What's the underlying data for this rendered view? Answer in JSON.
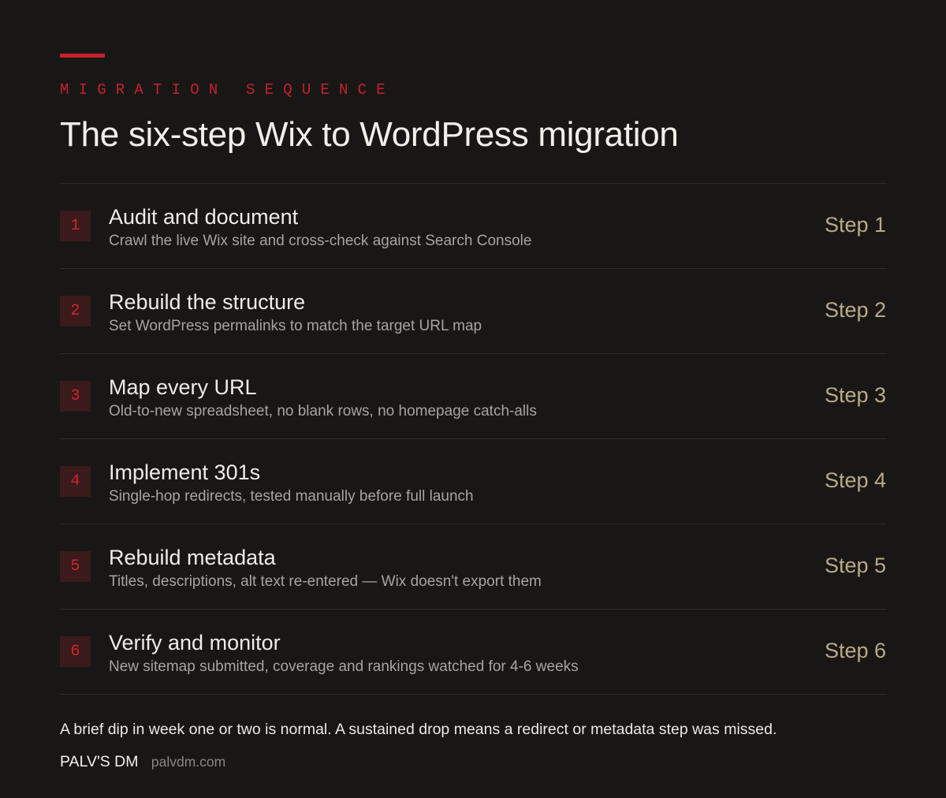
{
  "header": {
    "eyebrow": "MIGRATION SEQUENCE",
    "title": "The six-step Wix to WordPress migration"
  },
  "steps": [
    {
      "number": "1",
      "title": "Audit and document",
      "description": "Crawl the live Wix site and cross-check against Search Console",
      "tag": "Step 1"
    },
    {
      "number": "2",
      "title": "Rebuild the structure",
      "description": "Set WordPress permalinks to match the target URL map",
      "tag": "Step 2"
    },
    {
      "number": "3",
      "title": "Map every URL",
      "description": "Old-to-new spreadsheet, no blank rows, no homepage catch-alls",
      "tag": "Step 3"
    },
    {
      "number": "4",
      "title": "Implement 301s",
      "description": "Single-hop redirects, tested manually before full launch",
      "tag": "Step 4"
    },
    {
      "number": "5",
      "title": "Rebuild metadata",
      "description": "Titles, descriptions, alt text re-entered — Wix doesn't export them",
      "tag": "Step 5"
    },
    {
      "number": "6",
      "title": "Verify and monitor",
      "description": "New sitemap submitted, coverage and rankings watched for 4-6 weeks",
      "tag": "Step 6"
    }
  ],
  "footer": {
    "note": "A brief dip in week one or two is normal. A sustained drop means a redirect or metadata step was missed.",
    "brand": "PALV'S DM",
    "url": "palvdm.com"
  },
  "colors": {
    "background": "#181716",
    "accent": "#c8202a",
    "badge_background": "#3a1a1a",
    "step_tag": "#b9aa86",
    "divider": "#2f2d2b"
  }
}
